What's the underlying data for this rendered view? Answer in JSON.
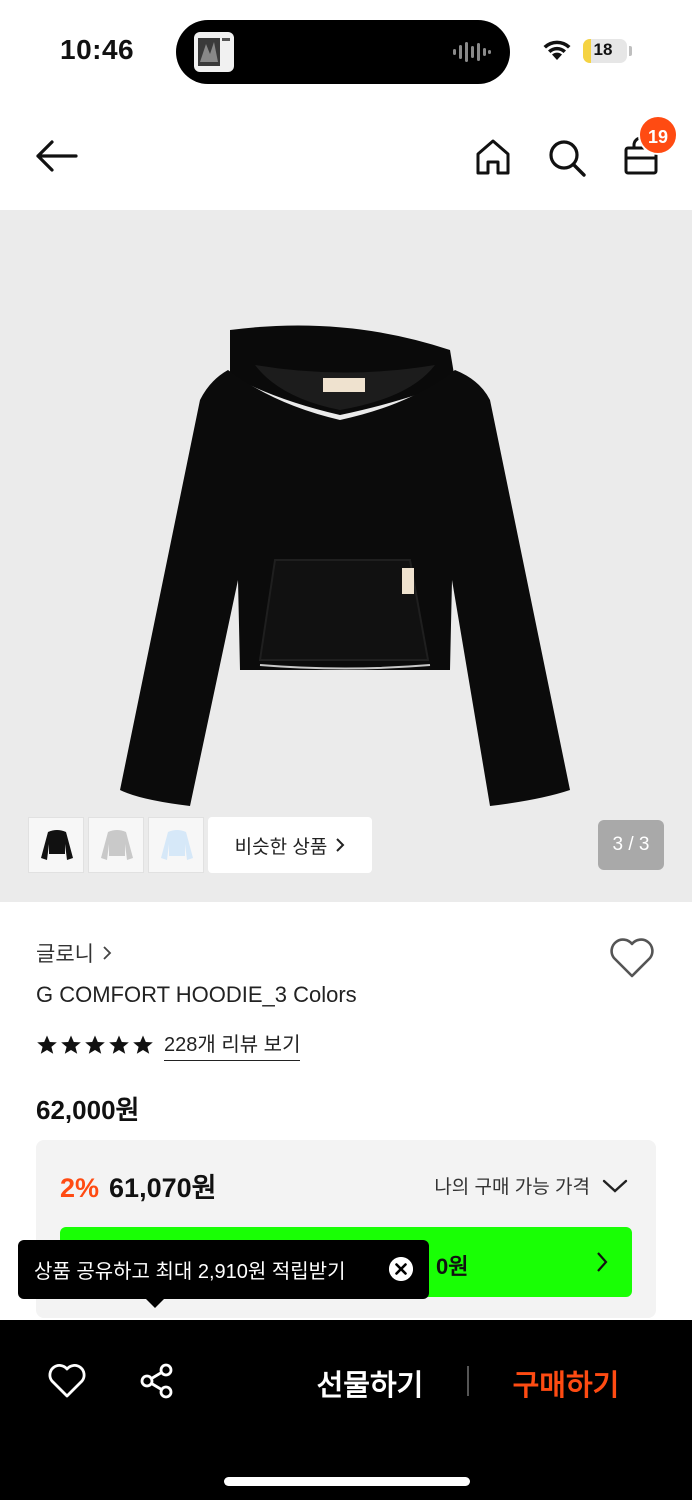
{
  "status_bar": {
    "time": "10:46",
    "battery": "18",
    "battery_level": 0.18
  },
  "nav": {
    "cart_count": "19"
  },
  "gallery": {
    "page_indicator": "3 / 3",
    "similar_label": "비슷한 상품",
    "thumbnails": [
      "black",
      "gray",
      "light-blue"
    ]
  },
  "product": {
    "brand": "글로니",
    "name": "G COMFORT HOODIE_3 Colors",
    "rating": 5,
    "review_link": "228개 리뷰 보기",
    "price": "62,000원",
    "discount_rate": "2%",
    "discount_price": "61,070원",
    "my_price_label": "나의 구매 가능 가격",
    "green_button_text": "0원"
  },
  "tooltip": {
    "text": "상품 공유하고 최대 2,910원 적립받기"
  },
  "bottom_bar": {
    "gift_label": "선물하기",
    "buy_label": "구매하기"
  },
  "colors": {
    "accent": "#ff4b12",
    "green": "#19ff05",
    "image_bg": "#ebebeb"
  }
}
